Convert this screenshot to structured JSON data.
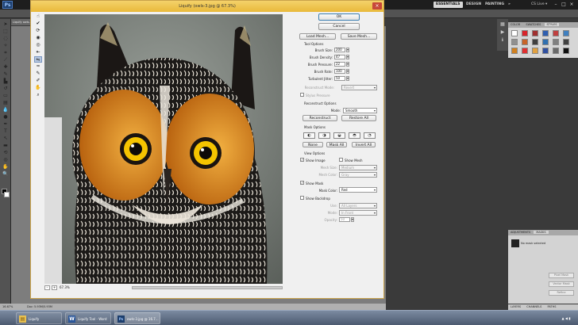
{
  "app": {
    "logo": "Ps",
    "workspaces": [
      "ESSENTIALS",
      "DESIGN",
      "PAINTING"
    ],
    "workspace_more": "»",
    "cs_live": "CS Live ▾",
    "window_controls": [
      "–",
      "□",
      "×"
    ]
  },
  "document": {
    "tab_title": "Liquify owls-3.jpg",
    "status_zoom": "16.67%",
    "status_doc": "Doc: 5.93M/5.93M"
  },
  "dialog": {
    "title": "Liquify (owls-3.jpg @ 67.3%)",
    "close": "×",
    "ok": "OK",
    "cancel": "Cancel",
    "load_mesh": "Load Mesh...",
    "save_mesh": "Save Mesh...",
    "tool_options_title": "Tool Options",
    "tool_options": [
      {
        "label": "Brush Size:",
        "value": "200"
      },
      {
        "label": "Brush Density:",
        "value": "47"
      },
      {
        "label": "Brush Pressure:",
        "value": "22"
      },
      {
        "label": "Brush Rate:",
        "value": "100"
      },
      {
        "label": "Turbulent Jitter:",
        "value": "50"
      }
    ],
    "reconstruct_mode_label": "Reconstruct Mode:",
    "reconstruct_mode_value": "Revert",
    "stylus_pressure": "Stylus Pressure",
    "reconstruct_options_title": "Reconstruct Options",
    "reconstruct_mode": "Mode:",
    "reconstruct_mode_select": "Smooth",
    "reconstruct_btn": "Reconstruct",
    "restore_all": "Restore All",
    "mask_options_title": "Mask Options",
    "none_btn": "None",
    "mask_all": "Mask All",
    "invert_all": "Invert All",
    "view_options_title": "View Options",
    "show_image": "Show Image",
    "show_mesh": "Show Mesh",
    "mesh_size_label": "Mesh Size:",
    "mesh_size_value": "Medium",
    "mesh_color_label": "Mesh Color:",
    "mesh_color_value": "Gray",
    "show_mask": "Show Mask",
    "mask_color_label": "Mask Color:",
    "mask_color_value": "Red",
    "show_backdrop": "Show Backdrop",
    "use_label": "Use:",
    "use_value": "All Layers",
    "bd_mode_label": "Mode:",
    "bd_mode_value": "In Front",
    "opacity_label": "Opacity:",
    "opacity_value": "50",
    "zoom_minus": "–",
    "zoom_plus": "+",
    "zoom_value": "67.3%",
    "mask_glyphs": [
      "◐",
      "◑",
      "◒",
      "◓",
      "◔"
    ],
    "check_mark": "✓"
  },
  "panels": {
    "swatches_tabs": [
      "COLOR",
      "SWATCHES",
      "STYLES"
    ],
    "adjust_tabs": [
      "ADJUSTMENTS",
      "MASKS"
    ],
    "adjust_text": "No mask selected",
    "adjust_buttons": [
      "Pixel Mask",
      "Vector Mask",
      "Refine"
    ],
    "layers_tabs": [
      "LAYERS",
      "CHANNELS",
      "PATHS"
    ],
    "swatch_colors": [
      "#ffffff",
      "#d8242b",
      "#a03030",
      "#2f5fb0",
      "#c04040",
      "#4080c0",
      "#909090",
      "#c86428",
      "#404040",
      "#3070b0",
      "#808080",
      "#404040",
      "#d08020",
      "#e03030",
      "#e0a040",
      "#3050a0",
      "#6a6a6a",
      "#101010"
    ]
  },
  "taskbar": {
    "items": [
      {
        "label": "Liquify",
        "icon": "folder-icon",
        "glyph": "▤"
      },
      {
        "label": "Liquify Tool - Word",
        "icon": "word-icon",
        "glyph": "W"
      },
      {
        "label": "owls-3.jpg @ 16.7...",
        "icon": "photoshop-icon",
        "glyph": "Ps"
      }
    ],
    "tray": "▲ ◀ ▮"
  },
  "colors": {
    "accent": "#e9b93a",
    "owl_orange": "#e08a1e",
    "owl_eye": "#f5c400"
  }
}
